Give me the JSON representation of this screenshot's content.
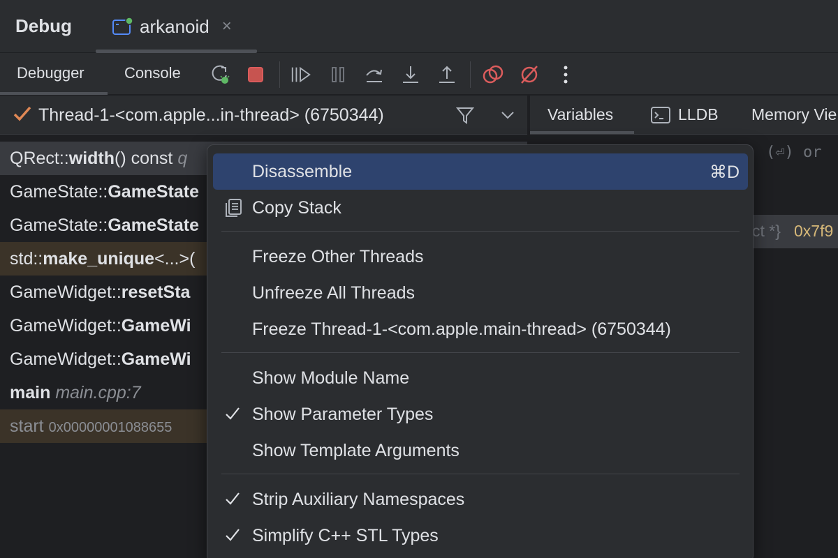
{
  "window": {
    "title": "Debug",
    "run_tab": "arkanoid",
    "close_glyph": "×"
  },
  "toolbar": {
    "tabs": [
      "Debugger",
      "Console"
    ],
    "icons": [
      "rerun-icon",
      "stop-icon",
      "resume-icon",
      "pause-icon",
      "step-over-icon",
      "step-into-icon",
      "step-out-icon",
      "view-breakpoints-icon",
      "mute-breakpoints-icon",
      "more-icon"
    ]
  },
  "thread": {
    "label": "Thread-1-<com.apple...in-thread> (6750344)"
  },
  "frames": [
    {
      "prefix": "QRect::",
      "name": "width",
      "suffix": "() const ",
      "loc": "q",
      "style": "sel"
    },
    {
      "prefix": "GameState::",
      "name": "GameState",
      "suffix": "",
      "loc": "",
      "style": ""
    },
    {
      "prefix": "GameState::",
      "name": "GameState",
      "suffix": "",
      "loc": "",
      "style": ""
    },
    {
      "prefix": "std::",
      "name": "make_unique",
      "suffix": "<...>(",
      "loc": "",
      "style": "lib"
    },
    {
      "prefix": "GameWidget::",
      "name": "resetSta",
      "suffix": "",
      "loc": "",
      "style": ""
    },
    {
      "prefix": "GameWidget::",
      "name": "GameWi",
      "suffix": "",
      "loc": "",
      "style": ""
    },
    {
      "prefix": "GameWidget::",
      "name": "GameWi",
      "suffix": "",
      "loc": "",
      "style": ""
    },
    {
      "prefix": "",
      "name": "main",
      "suffix": " ",
      "loc": "main.cpp:7",
      "style": ""
    },
    {
      "prefix": "start ",
      "name": "",
      "suffix": "",
      "loc": "0x00000001088655",
      "style": "lib muted"
    }
  ],
  "right_panel": {
    "tabs": [
      "Variables",
      "LLDB",
      "Memory Vie"
    ],
    "hint": "(⏎) or",
    "var_type": "ct *}",
    "var_value": "0x7f9"
  },
  "menu": {
    "items": [
      {
        "label": "Disassemble",
        "shortcut": "⌘D",
        "highlighted": true,
        "icon": ""
      },
      {
        "label": "Copy Stack",
        "shortcut": "",
        "highlighted": false,
        "icon": "copy-icon"
      },
      {
        "label": "Freeze Other Threads",
        "shortcut": "",
        "highlighted": false,
        "icon": ""
      },
      {
        "label": "Unfreeze All Threads",
        "shortcut": "",
        "highlighted": false,
        "icon": ""
      },
      {
        "label": "Freeze Thread-1-<com.apple.main-thread> (6750344)",
        "shortcut": "",
        "highlighted": false,
        "icon": ""
      },
      {
        "label": "Show Module Name",
        "shortcut": "",
        "highlighted": false,
        "icon": ""
      },
      {
        "label": "Show Parameter Types",
        "shortcut": "",
        "highlighted": false,
        "icon": "check-icon"
      },
      {
        "label": "Show Template Arguments",
        "shortcut": "",
        "highlighted": false,
        "icon": ""
      },
      {
        "label": "Strip Auxiliary Namespaces",
        "shortcut": "",
        "highlighted": false,
        "icon": "check-icon"
      },
      {
        "label": "Simplify C++ STL Types",
        "shortcut": "",
        "highlighted": false,
        "icon": "check-icon"
      }
    ]
  },
  "colors": {
    "accent_highlight": "#2e436e",
    "stop_red": "#db5c5c",
    "run_green": "#5fb865",
    "check_orange": "#e08855"
  }
}
